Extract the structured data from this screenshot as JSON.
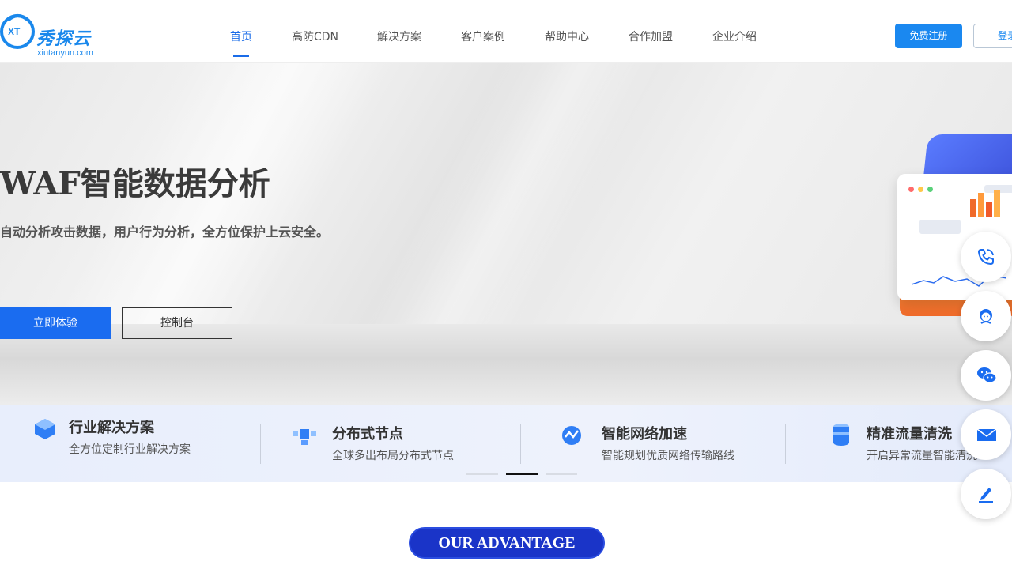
{
  "brand": {
    "logo_text": "秀探云",
    "logo_url": "xiutanyun.com",
    "logo_badge": "XT"
  },
  "nav": {
    "items": [
      {
        "label": "首页",
        "active": true
      },
      {
        "label": "高防CDN"
      },
      {
        "label": "解决方案"
      },
      {
        "label": "客户案例"
      },
      {
        "label": "帮助中心"
      },
      {
        "label": "合作加盟"
      },
      {
        "label": "企业介绍"
      }
    ],
    "register": "免费注册",
    "login": "登录"
  },
  "hero": {
    "title": "WAF智能数据分析",
    "subtitle": "自动分析攻击数据，用户行为分析，全方位保护上云安全。",
    "cta_primary": "立即体验",
    "cta_secondary": "控制台"
  },
  "features": [
    {
      "title": "行业解决方案",
      "desc": "全方位定制行业解决方案",
      "icon": "box-icon"
    },
    {
      "title": "分布式节点",
      "desc": "全球多出布局分布式节点",
      "icon": "cube-network-icon"
    },
    {
      "title": "智能网络加速",
      "desc": "智能规划优质网络传输路线",
      "icon": "speed-icon"
    },
    {
      "title": "精准流量清洗",
      "desc": "开启异常流量智能清洗",
      "icon": "database-icon"
    }
  ],
  "carousel": {
    "total": 3,
    "active": 2
  },
  "side_buttons": [
    "phone-icon",
    "customer-service-icon",
    "wechat-icon",
    "mail-icon",
    "edit-icon"
  ],
  "advantage": {
    "label": "OUR ADVANTAGE"
  },
  "colors": {
    "primary": "#1a6cf0",
    "register": "#1a88f0",
    "advantage": "#1a34c8"
  }
}
